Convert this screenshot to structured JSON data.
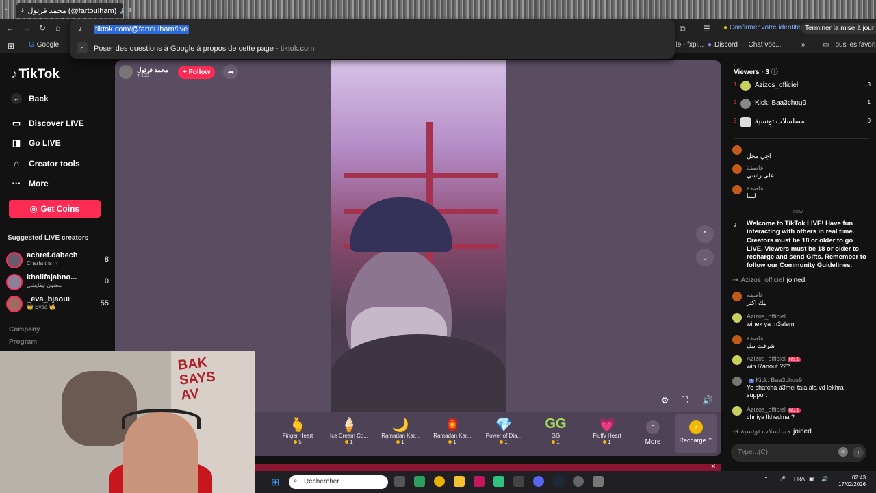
{
  "browser": {
    "tab_title": "محمد فرتول (@fartoulham)",
    "url": "tiktok.com/@fartoulham/live",
    "suggestion": "Poser des questions à Google à propos de cette page",
    "suggestion_domain": "tiktok.com",
    "confirm_identity": "Confirmer votre identité",
    "finish_update": "Terminer la mise à jour",
    "bookmarks": [
      {
        "label": "Google"
      },
      {
        "label": "gle - fxpi..."
      },
      {
        "label": "Discord — Chat voc..."
      },
      {
        "label": "Tous les favoris"
      }
    ]
  },
  "sidebar": {
    "brand": "TikTok",
    "back": "Back",
    "items": [
      {
        "label": "Discover LIVE",
        "icon": "tv-icon"
      },
      {
        "label": "Go LIVE",
        "icon": "camera-icon"
      },
      {
        "label": "Creator tools",
        "icon": "creator-tools-icon"
      },
      {
        "label": "More",
        "icon": "more-dots-icon"
      }
    ],
    "get_coins": "Get Coins",
    "suggested_title": "Suggested LIVE creators",
    "creators": [
      {
        "name": "achref.dabech",
        "sub": "Charfa tnsтn",
        "count": "8"
      },
      {
        "name": "khalifajabno...",
        "sub": "مجنون تيفايشي",
        "count": "0"
      },
      {
        "name": "_eva_bjaoui",
        "sub": "👑 Evaa 👑",
        "count": "55"
      }
    ],
    "footer": [
      "Company",
      "Program"
    ]
  },
  "host": {
    "name": "محمد فرتول",
    "likes": "103",
    "follow": "+ Follow"
  },
  "gifts": [
    {
      "name": "Finger Heart",
      "cost": "5",
      "icon": "🫰"
    },
    {
      "name": "Ice Cream Co...",
      "cost": "1",
      "icon": "🍦"
    },
    {
      "name": "Ramadan Kar...",
      "cost": "1",
      "icon": "🌙"
    },
    {
      "name": "Ramadan Kar...",
      "cost": "1",
      "icon": "🏮"
    },
    {
      "name": "Power of Dia...",
      "cost": "1",
      "icon": "💎"
    },
    {
      "name": "GG",
      "cost": "1",
      "icon": "GG"
    },
    {
      "name": "Fluffy Heart",
      "cost": "1",
      "icon": "💗"
    }
  ],
  "gift_more": "More",
  "recharge": "Recharge",
  "viewers": {
    "title": "Viewers · 3",
    "list": [
      {
        "rank": "1",
        "name": "Azizos_officiel",
        "count": "3"
      },
      {
        "rank": "2",
        "name": "Kick: Baa3chou9",
        "count": "1"
      },
      {
        "rank": "3",
        "name": "مسلسلات تونسية",
        "count": "0"
      }
    ]
  },
  "chat": {
    "early": [
      {
        "user": "",
        "text": "اجي محل"
      },
      {
        "user": "عاصفة",
        "text": "على راسي"
      },
      {
        "user": "عاصفة",
        "text": "ليبيا"
      }
    ],
    "now_label": "Now",
    "welcome": "Welcome to TikTok LIVE! Have fun interacting with others in real time. Creators must be 18 or older to go LIVE. Viewers must be 18 or older to recharge and send Gifts. Remember to follow our Community Guidelines.",
    "join1_user": "Azizos_officiel",
    "join1_text": "joined",
    "m1_user": "عاصفة",
    "m1_text": "بيك اكثر",
    "m2_user": "Azizos_officiel",
    "m2_text": "winek ya m3alem",
    "m3_user": "عاصفة",
    "m3_text": "شرفت بيك",
    "m4_user": "Azizos_officiel",
    "m4_badge": "No.1",
    "m4_text": "win l7anout ???",
    "m5_user": "Kick: Baa3chou9",
    "m5_text": "Ye chafcha a3mel tala ala vd lekhra",
    "m5_text2": "support",
    "m6_user": "Azizos_officiel",
    "m6_badge": "No.1",
    "m6_text": "chniya lkhedma ?",
    "join2_user": "مسلسلات تونسية",
    "join2_text": "joined",
    "input_placeholder": "Type...(C)"
  },
  "taskbar": {
    "search": "Rechercher",
    "lang": "FRA",
    "time": "02:43",
    "date": "17/02/2026"
  },
  "webcam": {
    "graffiti": "BAK\nSAYS\nAV"
  }
}
